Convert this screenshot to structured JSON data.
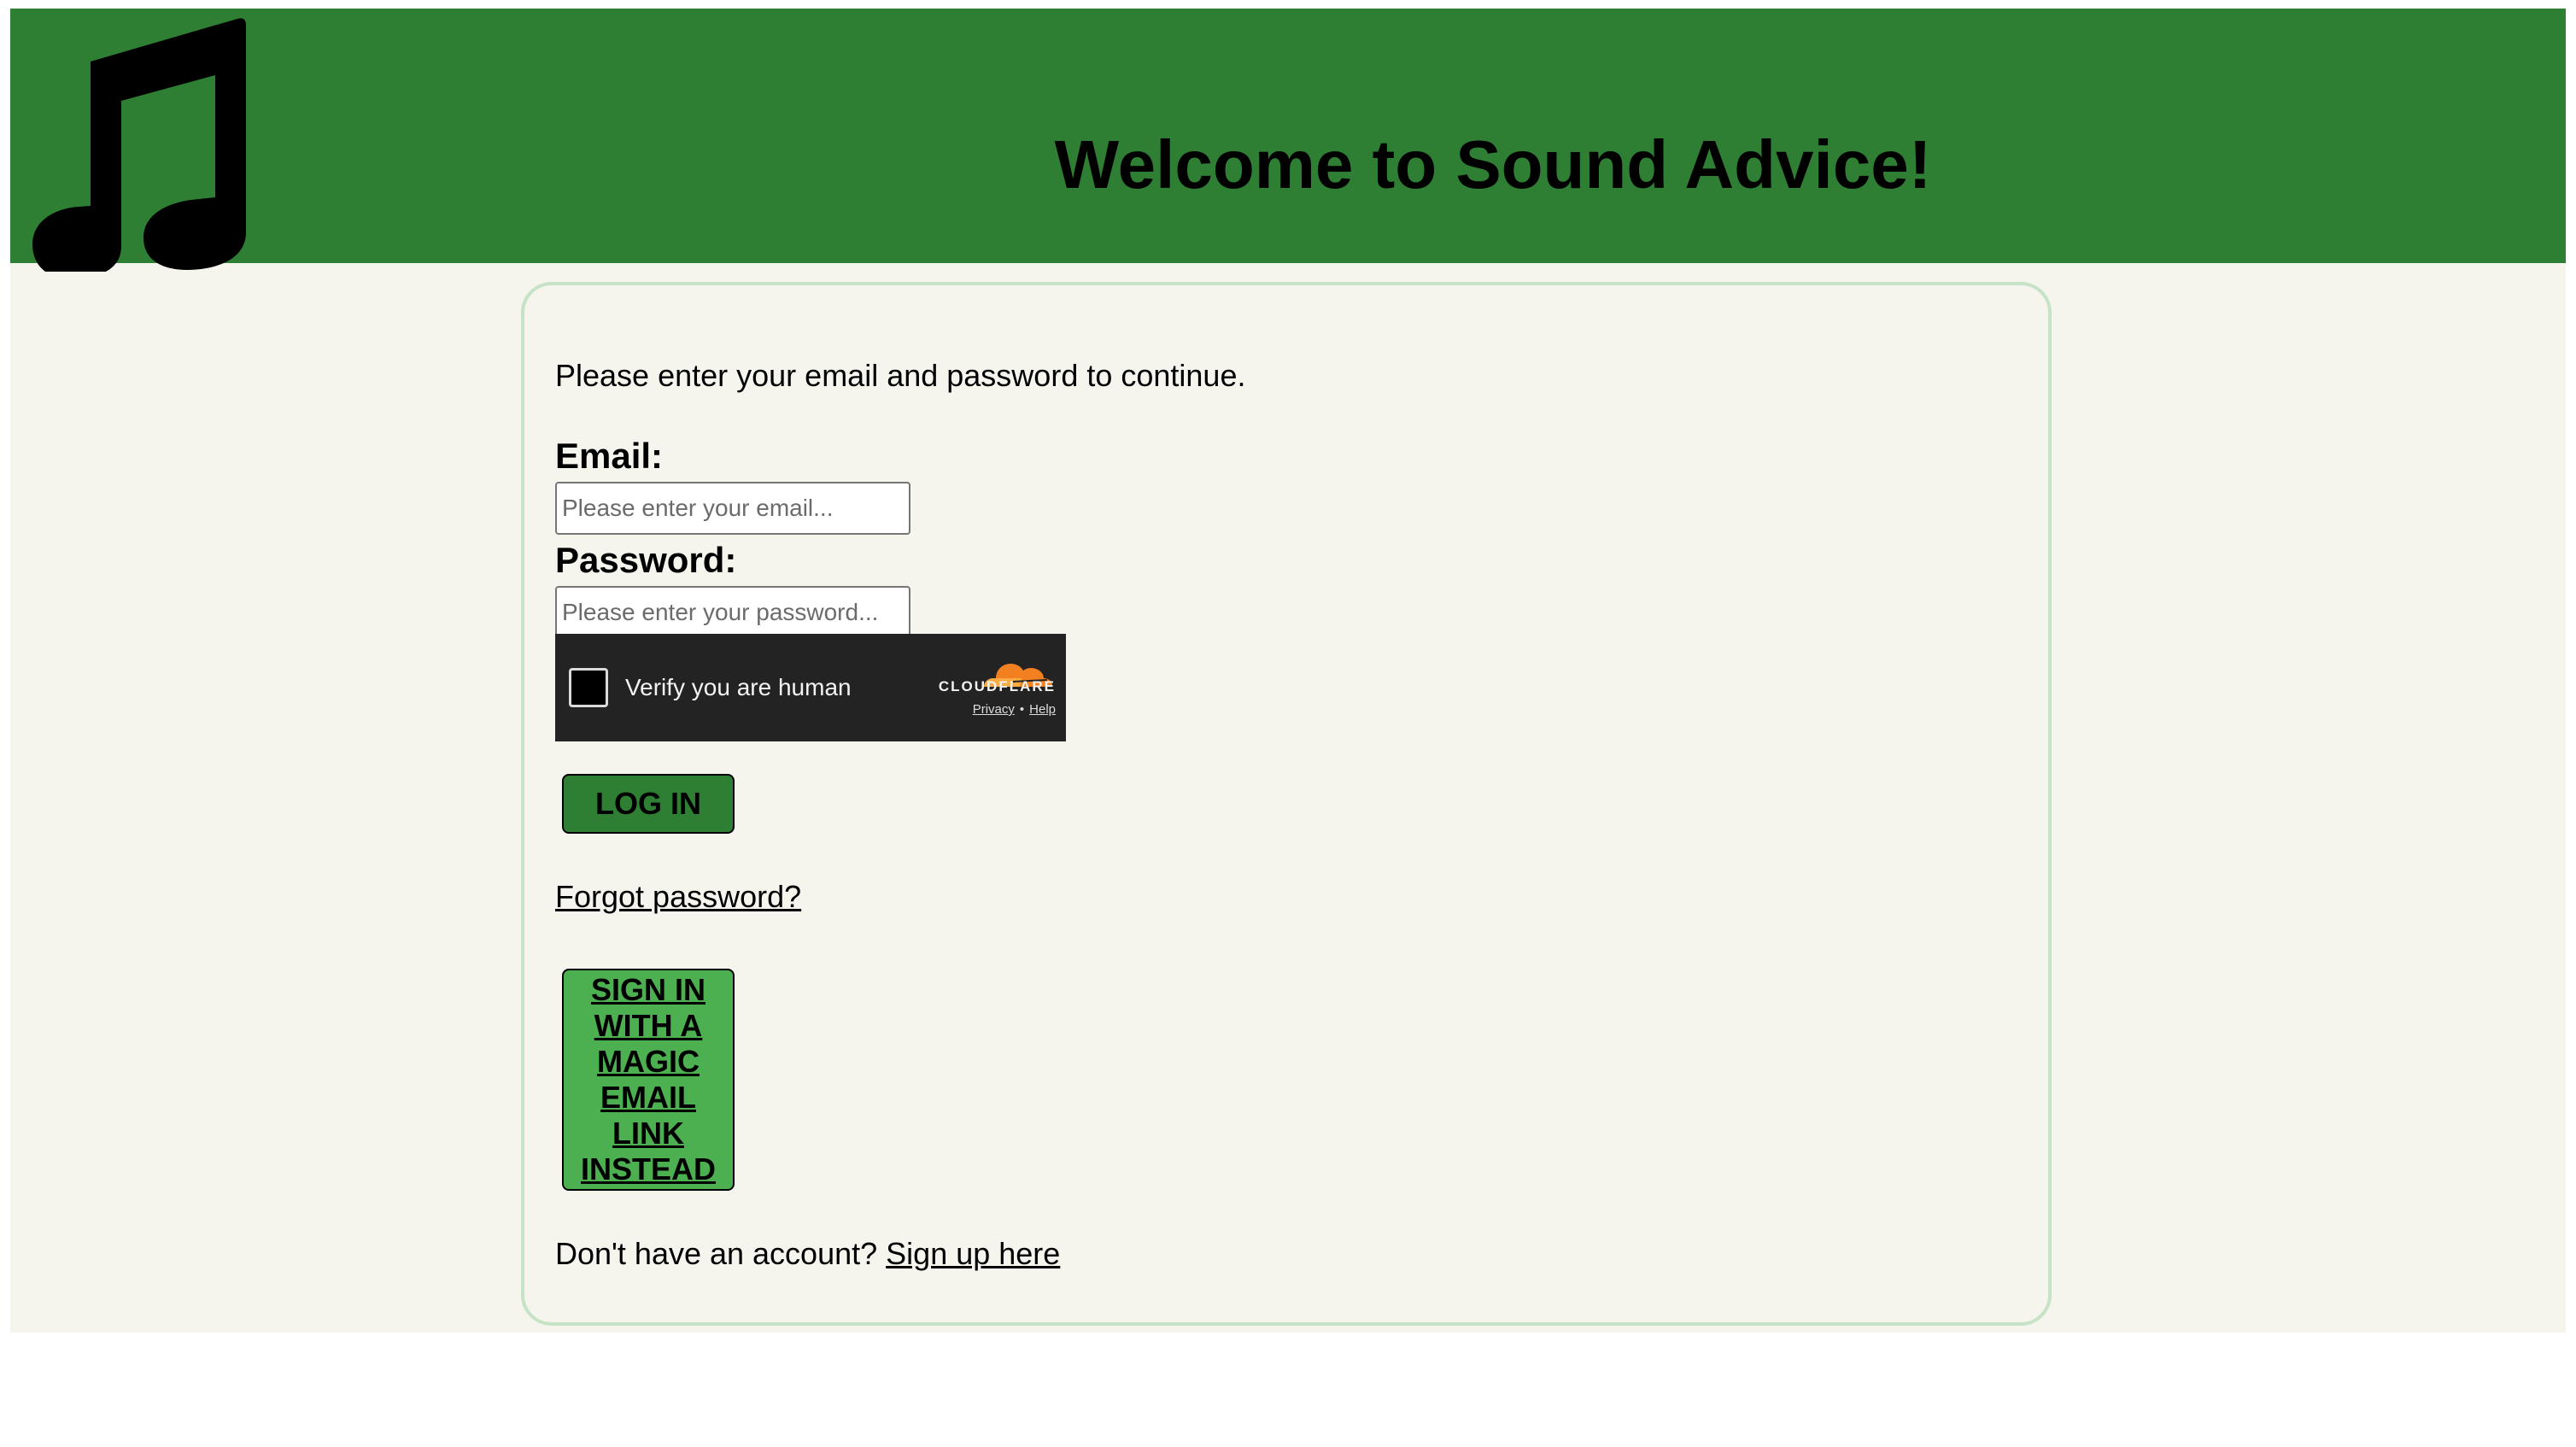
{
  "header": {
    "logo_icon": "music-note-icon",
    "title": "Welcome to Sound Advice!",
    "background_color": "#2e7f34"
  },
  "login_form": {
    "intro": "Please enter your email and password to continue.",
    "email": {
      "label": "Email:",
      "placeholder": "Please enter your email...",
      "value": ""
    },
    "password": {
      "label": "Password:",
      "placeholder": "Please enter your password...",
      "value": ""
    },
    "captcha": {
      "checkbox_checked": false,
      "label": "Verify you are human",
      "brand": "CLOUDFLARE",
      "privacy_link": "Privacy",
      "separator": "•",
      "help_link": "Help",
      "brand_color": "#f38020"
    },
    "login_button": "LOG IN",
    "login_button_color": "#2e7f34",
    "forgot_password_link": "Forgot password?",
    "magic_link_button": "SIGN IN WITH A MAGIC EMAIL LINK INSTEAD",
    "magic_link_button_color": "#4caf50",
    "signup_prompt": "Don't have an account?",
    "signup_link": "Sign up here"
  },
  "colors": {
    "page_background": "#f5f5ee",
    "card_border": "#c6e3c6"
  }
}
